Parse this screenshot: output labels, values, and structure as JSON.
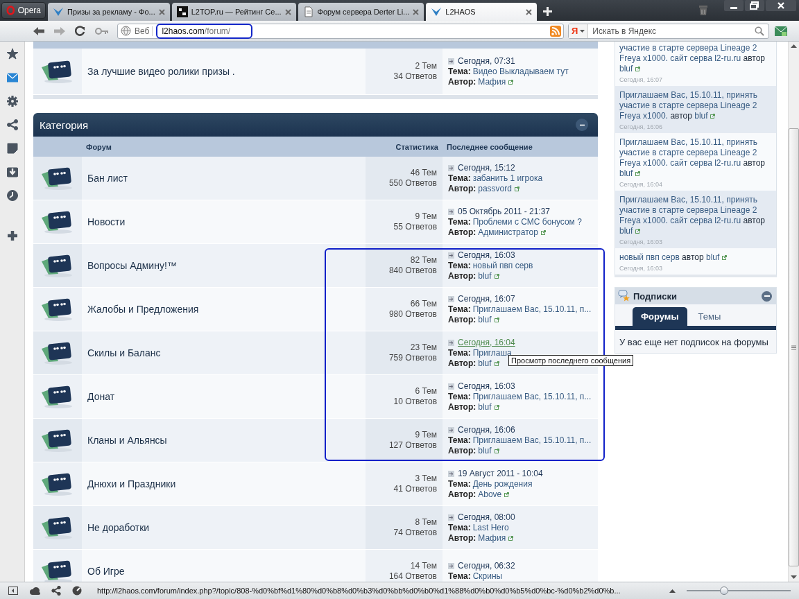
{
  "browser": {
    "menu_button": "Opera",
    "tabs": [
      {
        "title": "Призы за рекламу - Фо...",
        "selected": false,
        "kind": "forum"
      },
      {
        "title": "L2TOP.ru — Рейтинг Се...",
        "selected": false,
        "kind": "rating"
      },
      {
        "title": "Форум сервера Derter Li...",
        "selected": false,
        "kind": "page"
      },
      {
        "title": "L2HAOS",
        "selected": true,
        "kind": "forum"
      }
    ],
    "address": {
      "label": "Веб",
      "domain": "l2haos.com",
      "path": "/forum/",
      "circled": true
    },
    "search": {
      "engine_logo": "Я",
      "placeholder": "Искать в Яндекс"
    }
  },
  "side_panel": [
    {
      "kind": "star",
      "active": false
    },
    {
      "kind": "mail",
      "active": true
    },
    {
      "kind": "gear",
      "active": false
    },
    {
      "kind": "share",
      "active": false
    },
    {
      "kind": "note",
      "active": false
    },
    {
      "kind": "download",
      "active": false
    },
    {
      "kind": "clock",
      "active": false
    },
    {
      "kind": "plus",
      "active": false
    }
  ],
  "top_forum": {
    "name": "За лучшие видео ролики призы .",
    "topics": "2 Тем",
    "replies": "34 Ответов",
    "last_post": {
      "date": "Сегодня, 07:31",
      "topic_label": "Тема:",
      "topic": "Видео Выкладываем тут",
      "author_label": "Автор:",
      "author": "Мафия",
      "hovered": false
    }
  },
  "category": {
    "title": "Категория",
    "expanded": true,
    "columns": [
      "Форум",
      "Статистика",
      "Последнее сообщение"
    ],
    "rows": [
      {
        "name": "Бан лист",
        "topics": "46 Тем",
        "replies": "550 Ответов",
        "last_post": {
          "date": "Сегодня, 15:12",
          "topic_label": "Тема:",
          "topic": "забанить 1 игрока",
          "author_label": "Автор:",
          "author": "passvord",
          "hovered": false
        },
        "circled": false
      },
      {
        "name": "Новости",
        "topics": "9 Тем",
        "replies": "55 Ответов",
        "last_post": {
          "date": "05 Октябрь 2011 - 21:37",
          "topic_label": "Тема:",
          "topic": "Проблеми с СМС бонусом ?",
          "author_label": "Автор:",
          "author": "Администратор",
          "hovered": false
        },
        "circled": false
      },
      {
        "name": "Вопросы Админу!™",
        "topics": "82 Тем",
        "replies": "840 Ответов",
        "last_post": {
          "date": "Сегодня, 16:03",
          "topic_label": "Тема:",
          "topic": "новый пвп серв",
          "author_label": "Автор:",
          "author": "bluf",
          "hovered": false
        },
        "circled": true
      },
      {
        "name": "Жалобы и Предложения",
        "topics": "66 Тем",
        "replies": "980 Ответов",
        "last_post": {
          "date": "Сегодня, 16:07",
          "topic_label": "Тема:",
          "topic": "Приглашаем Вас, 15.10.11, п...",
          "author_label": "Автор:",
          "author": "bluf",
          "hovered": false
        },
        "circled": true
      },
      {
        "name": "Скилы и Баланс",
        "topics": "23 Тем",
        "replies": "759 Ответов",
        "last_post": {
          "date": "Сегодня, 16:04",
          "topic_label": "Тема:",
          "topic": "Приглаша",
          "author_label": "Автор:",
          "author": "bluf",
          "hovered": true
        },
        "circled": true
      },
      {
        "name": "Донат",
        "topics": "6 Тем",
        "replies": "10 Ответов",
        "last_post": {
          "date": "Сегодня, 16:03",
          "topic_label": "Тема:",
          "topic": "Приглашаем Вас, 15.10.11, п...",
          "author_label": "Автор:",
          "author": "bluf",
          "hovered": false
        },
        "circled": true
      },
      {
        "name": "Кланы и Альянсы",
        "topics": "9 Тем",
        "replies": "127 Ответов",
        "last_post": {
          "date": "Сегодня, 16:06",
          "topic_label": "Тема:",
          "topic": "Приглашаем Вас, 15.10.11, п...",
          "author_label": "Автор:",
          "author": "bluf",
          "hovered": false
        },
        "circled": true
      },
      {
        "name": "Днюхи и Праздники",
        "topics": "3 Тем",
        "replies": "41 Ответов",
        "last_post": {
          "date": "19 Август 2011 - 10:04",
          "topic_label": "Тема:",
          "topic": "День рождения",
          "author_label": "Автор:",
          "author": "Above",
          "hovered": false
        },
        "circled": false
      },
      {
        "name": "Не доработки",
        "topics": "8 Тем",
        "replies": "74 Ответов",
        "last_post": {
          "date": "Сегодня, 08:00",
          "topic_label": "Тема:",
          "topic": "Last Hero",
          "author_label": "Автор:",
          "author": "Мафия",
          "hovered": false
        },
        "circled": false
      },
      {
        "name": "Об Игре",
        "topics": "14 Тем",
        "replies": "164 Ответов",
        "last_post": {
          "date": "Сегодня, 06:32",
          "topic_label": "Тема:",
          "topic": "Скрины",
          "hovered": false
        },
        "circled": false
      }
    ]
  },
  "tooltip": {
    "text": "Просмотр последнего сообщения"
  },
  "recent_posts": [
    {
      "text": "участие в старте сервера Lineage 2 Freya x1000. сайт серва l2-ru.ru",
      "by": "автор",
      "author": "bluf",
      "time": "Сегодня, 16:07"
    },
    {
      "text": "Приглашаем Вас, 15.10.11, принять участие в старте сервера Lineage 2 Freya x1000.",
      "by": "автор",
      "author": "bluf",
      "time": "Сегодня, 16:06"
    },
    {
      "text": "Приглашаем Вас, 15.10.11, принять участие в старте сервера Lineage 2 Freya x1000. сайт серва l2-ru.ru",
      "by": "автор",
      "author": "bluf",
      "time": "Сегодня, 16:04"
    },
    {
      "text": "Приглашаем Вас, 15.10.11, принять участие в старте сервера Lineage 2 Freya x1000. сайт серва l2-ru.ru",
      "by": "автор",
      "author": "bluf",
      "time": "Сегодня, 16:03"
    },
    {
      "text": "новый пвп серв",
      "by": "автор",
      "author": "bluf",
      "time": "Сегодня, 16:03"
    }
  ],
  "subscriptions": {
    "title": "Подписки",
    "expanded": true,
    "tabs": [
      {
        "label": "Форумы",
        "selected": true
      },
      {
        "label": "Темы",
        "selected": false
      }
    ],
    "empty_text": "У вас еще нет подписок на форумы"
  },
  "status_bar": {
    "url": "http://l2haos.com/forum/index.php?/topic/808-%d0%bf%d1%80%d0%b8%d0%b3%d0%bb%d0%b0%d1%88%d0%b0%d0%b5%d0%bc-%d0%b2%d0%b...",
    "zoom": {
      "level": 0.36
    }
  }
}
